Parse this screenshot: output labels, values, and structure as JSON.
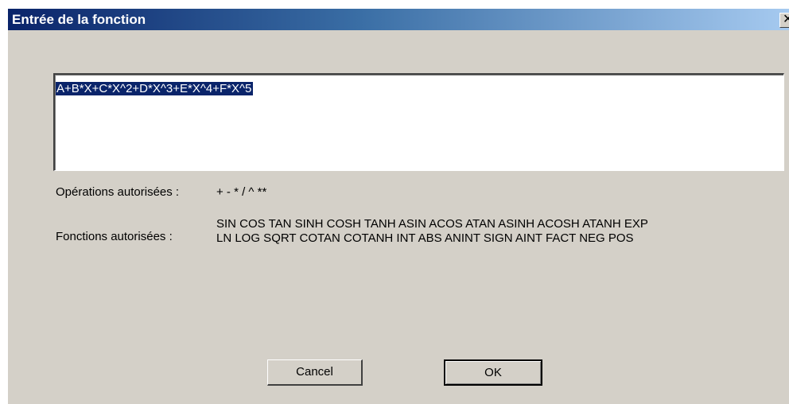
{
  "window": {
    "title": "Entrée de la fonction",
    "close_glyph": "✕"
  },
  "formula": {
    "value": "A+B*X+C*X^2+D*X^3+E*X^4+F*X^5"
  },
  "operations": {
    "label": "Opérations autorisées :",
    "value": "+ - * / ^ **"
  },
  "functions": {
    "label": "Fonctions autorisées :",
    "line1": "SIN COS TAN SINH COSH TANH ASIN ACOS ATAN ASINH ACOSH ATANH EXP",
    "line2": "LN LOG SQRT COTAN COTANH INT ABS ANINT SIGN AINT FACT NEG POS"
  },
  "buttons": {
    "cancel_label": "Cancel",
    "ok_label": "OK"
  }
}
